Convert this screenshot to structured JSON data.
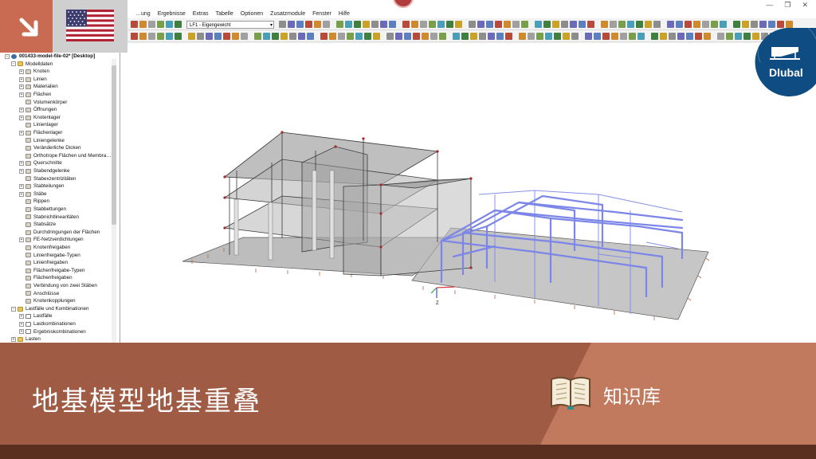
{
  "window": {
    "minimize": "—",
    "restore": "❐",
    "close": "✕"
  },
  "menu": [
    "…ung",
    "Ergebnisse",
    "Extras",
    "Tabelle",
    "Optionen",
    "Zusatzmodule",
    "Fenster",
    "Hilfe"
  ],
  "toolbar": {
    "loadcase_value": "LF1 - Eigengewicht"
  },
  "navigator": {
    "rows": [
      {
        "label": "001433-model-file-02* [Desktop]",
        "level": 0,
        "expander": "-",
        "icon": "model"
      },
      {
        "label": "Modelldaten",
        "level": 1,
        "expander": "-",
        "icon": "folder"
      },
      {
        "label": "Knoten",
        "level": 2,
        "expander": "+",
        "icon": "item"
      },
      {
        "label": "Linien",
        "level": 2,
        "expander": "+",
        "icon": "item"
      },
      {
        "label": "Materialien",
        "level": 2,
        "expander": "+",
        "icon": "item"
      },
      {
        "label": "Flächen",
        "level": 2,
        "expander": "+",
        "icon": "item"
      },
      {
        "label": "Volumenkörper",
        "level": 2,
        "expander": "",
        "icon": "item"
      },
      {
        "label": "Öffnungen",
        "level": 2,
        "expander": "+",
        "icon": "item"
      },
      {
        "label": "Knotenlager",
        "level": 2,
        "expander": "+",
        "icon": "item"
      },
      {
        "label": "Linienlager",
        "level": 2,
        "expander": "",
        "icon": "item"
      },
      {
        "label": "Flächenlager",
        "level": 2,
        "expander": "+",
        "icon": "item"
      },
      {
        "label": "Liniengelenke",
        "level": 2,
        "expander": "",
        "icon": "item"
      },
      {
        "label": "Veränderliche Dicken",
        "level": 2,
        "expander": "",
        "icon": "item"
      },
      {
        "label": "Orthotrope Flächen und Membra…",
        "level": 2,
        "expander": "",
        "icon": "item"
      },
      {
        "label": "Querschnitte",
        "level": 2,
        "expander": "+",
        "icon": "item"
      },
      {
        "label": "Stabendgelenke",
        "level": 2,
        "expander": "+",
        "icon": "item"
      },
      {
        "label": "Stabexzentrizitäten",
        "level": 2,
        "expander": "",
        "icon": "item"
      },
      {
        "label": "Stabteilungen",
        "level": 2,
        "expander": "+",
        "icon": "item"
      },
      {
        "label": "Stäbe",
        "level": 2,
        "expander": "+",
        "icon": "item"
      },
      {
        "label": "Rippen",
        "level": 2,
        "expander": "",
        "icon": "item"
      },
      {
        "label": "Stabbettungen",
        "level": 2,
        "expander": "",
        "icon": "item"
      },
      {
        "label": "Stabnichtlinearitäten",
        "level": 2,
        "expander": "",
        "icon": "item"
      },
      {
        "label": "Stabsätze",
        "level": 2,
        "expander": "",
        "icon": "item"
      },
      {
        "label": "Durchdringungen der Flächen",
        "level": 2,
        "expander": "",
        "icon": "item"
      },
      {
        "label": "FE-Netzverdichtungen",
        "level": 2,
        "expander": "+",
        "icon": "item"
      },
      {
        "label": "Knotenfreigaben",
        "level": 2,
        "expander": "",
        "icon": "item"
      },
      {
        "label": "Linienfreigabe-Typen",
        "level": 2,
        "expander": "",
        "icon": "item"
      },
      {
        "label": "Linienfreigaben",
        "level": 2,
        "expander": "",
        "icon": "item"
      },
      {
        "label": "Flächenfreigabe-Typen",
        "level": 2,
        "expander": "",
        "icon": "item"
      },
      {
        "label": "Flächenfreigaben",
        "level": 2,
        "expander": "",
        "icon": "item"
      },
      {
        "label": "Verbindung von zwei Stäben",
        "level": 2,
        "expander": "",
        "icon": "item"
      },
      {
        "label": "Anschlüsse",
        "level": 2,
        "expander": "",
        "icon": "item"
      },
      {
        "label": "Knotenkopplungen",
        "level": 2,
        "expander": "",
        "icon": "item"
      },
      {
        "label": "Lastfälle und Kombinationen",
        "level": 1,
        "expander": "-",
        "icon": "folder"
      },
      {
        "label": "Lastfälle",
        "level": 2,
        "expander": "+",
        "icon": "load"
      },
      {
        "label": "Lastkombinationen",
        "level": 2,
        "expander": "+",
        "icon": "load"
      },
      {
        "label": "Ergebniskombinationen",
        "level": 2,
        "expander": "+",
        "icon": "load"
      },
      {
        "label": "Lasten",
        "level": 1,
        "expander": "+",
        "icon": "folder"
      }
    ]
  },
  "viewport": {
    "axis_label": "Z"
  },
  "branding": {
    "company": "Dlubal",
    "language_flag": "us-flag-icon"
  },
  "banner": {
    "title": "地基模型地基重叠",
    "kb_label": "知识库"
  },
  "colors": {
    "accent": "#c96a52",
    "banner": "#a05b44",
    "banner_light": "#c27a5f",
    "dark_strip": "#5a2f20",
    "dlubal_blue": "#0f4c81",
    "steel_frame": "#7b86e8"
  }
}
